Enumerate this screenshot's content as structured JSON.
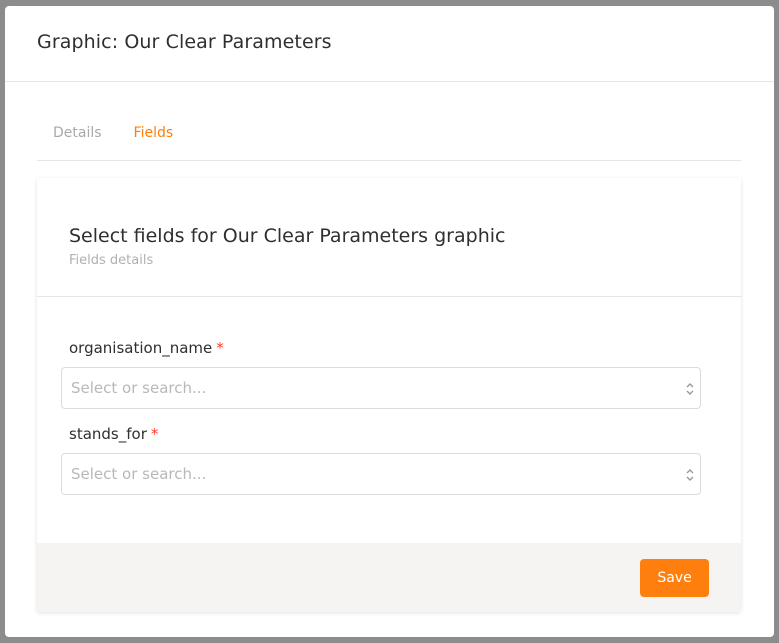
{
  "modal": {
    "title": "Graphic: Our Clear Parameters"
  },
  "tabs": [
    {
      "label": "Details",
      "active": false
    },
    {
      "label": "Fields",
      "active": true
    }
  ],
  "card": {
    "title": "Select fields for Our Clear Parameters graphic",
    "subtitle": "Fields details"
  },
  "fields": [
    {
      "label": "organisation_name",
      "required_mark": "*",
      "placeholder": "Select or search..."
    },
    {
      "label": "stands_for",
      "required_mark": "*",
      "placeholder": "Select or search..."
    }
  ],
  "footer": {
    "save_label": "Save"
  },
  "colors": {
    "accent": "#ff7f0e",
    "required": "#ff3b30"
  },
  "icons": {
    "select_arrows": "up-down-chevron-icon"
  }
}
